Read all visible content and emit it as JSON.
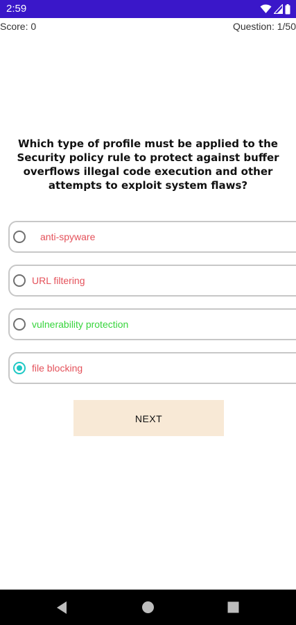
{
  "status_bar": {
    "time": "2:59",
    "background": "#3a17c9",
    "icons": [
      "wifi-icon",
      "cellular-signal-icon",
      "battery-icon"
    ]
  },
  "header": {
    "score": "Score: 0",
    "question_counter": "Question: 1/50"
  },
  "question": {
    "text": "Which type of profile must be applied to the Security policy rule to protect against buffer overflows illegal code execution and other attempts to exploit system flaws?"
  },
  "options": [
    {
      "label": "anti-spyware",
      "color": "#e4515a",
      "selected": false
    },
    {
      "label": "URL filtering",
      "color": "#e4515a",
      "selected": false
    },
    {
      "label": "vulnerability protection",
      "color": "#37d43c",
      "selected": false
    },
    {
      "label": "file blocking",
      "color": "#e4515a",
      "selected": true
    }
  ],
  "next_button": {
    "label": "NEXT",
    "background": "#f8e9d6"
  },
  "nav_bar": {
    "icons": [
      "back-icon",
      "home-icon",
      "recents-icon"
    ]
  },
  "colors": {
    "radio_selected": "#1ec8c5",
    "option_border": "#c7c7c7"
  }
}
